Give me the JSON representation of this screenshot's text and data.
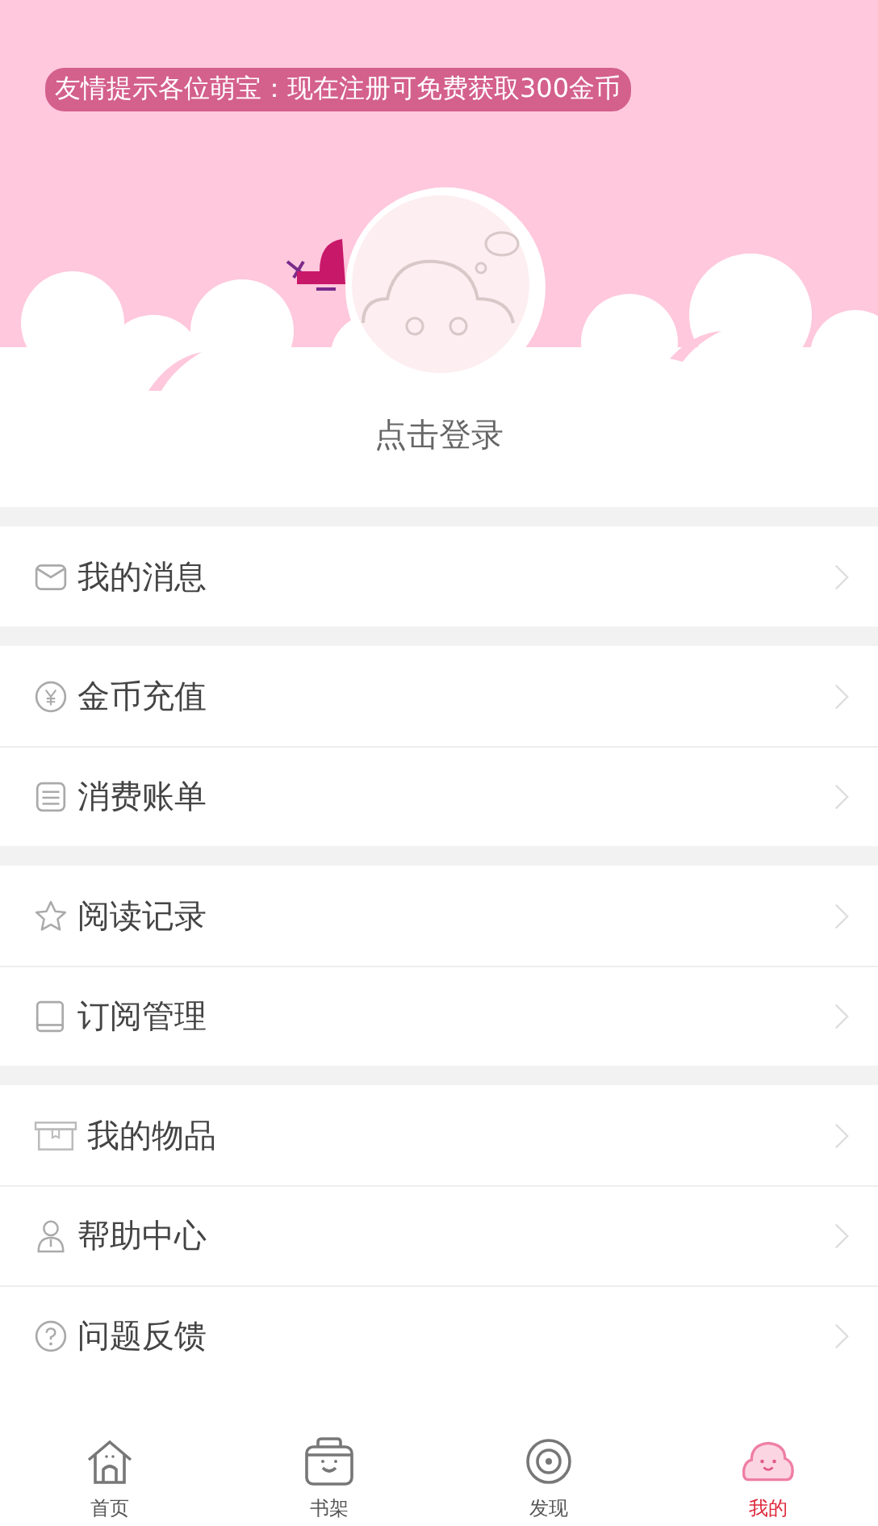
{
  "notice": "友情提示各位萌宝：现在注册可免费获取300金币",
  "login": "点击登录",
  "groups": [
    {
      "items": [
        {
          "label": "我的消息"
        }
      ]
    },
    {
      "items": [
        {
          "label": "金币充值"
        },
        {
          "label": "消费账单"
        }
      ]
    },
    {
      "items": [
        {
          "label": "阅读记录"
        },
        {
          "label": "订阅管理"
        }
      ]
    },
    {
      "items": [
        {
          "label": "我的物品"
        },
        {
          "label": "帮助中心"
        },
        {
          "label": "问题反馈"
        }
      ]
    }
  ],
  "tabs": [
    {
      "label": "首页",
      "selected": false
    },
    {
      "label": "书架",
      "selected": false
    },
    {
      "label": "发现",
      "selected": false
    },
    {
      "label": "我的",
      "selected": true
    }
  ]
}
